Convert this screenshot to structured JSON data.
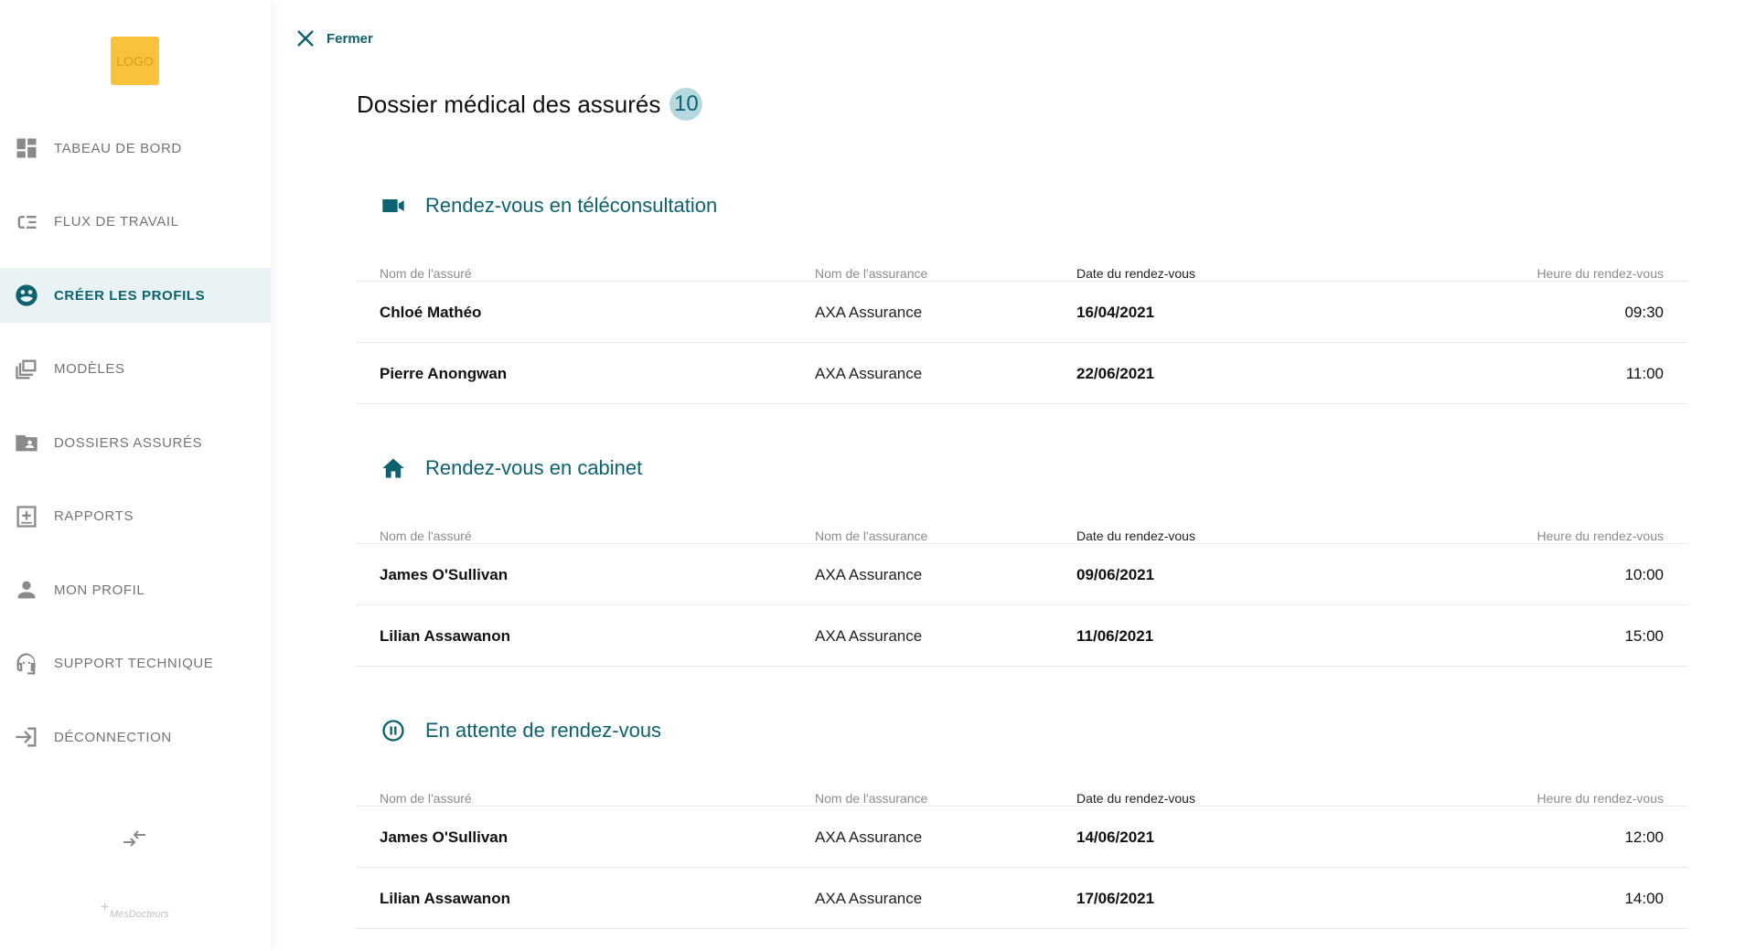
{
  "sidebar": {
    "logo_text": "LOGO",
    "items": [
      {
        "label": "TABEAU DE BORD",
        "icon": "dashboard-icon",
        "active": false
      },
      {
        "label": "FLUX DE TRAVAIL",
        "icon": "workflow-icon",
        "active": false
      },
      {
        "label": "CRÉER LES PROFILS",
        "icon": "profiles-icon",
        "active": true
      },
      {
        "label": "MODÈLES",
        "icon": "templates-icon",
        "active": false
      },
      {
        "label": "DOSSIERS ASSURÉS",
        "icon": "folder-user-icon",
        "active": false
      },
      {
        "label": "RAPPORTS",
        "icon": "report-icon",
        "active": false
      },
      {
        "label": "MON PROFIL",
        "icon": "person-icon",
        "active": false
      },
      {
        "label": "SUPPORT TECHNIQUE",
        "icon": "support-icon",
        "active": false
      },
      {
        "label": "DÉCONNECTION",
        "icon": "logout-icon",
        "active": false
      }
    ],
    "collapse_icon": "arrows-swap-icon",
    "brand_plus": "+",
    "brand_name": "MesDocteurs"
  },
  "header": {
    "close_label": "Fermer",
    "title": "Dossier médical des assurés",
    "count": "10"
  },
  "columns": {
    "name": "Nom de l'assuré",
    "insurance": "Nom de l'assurance",
    "date": "Date du rendez-vous",
    "time": "Heure du rendez-vous"
  },
  "sections": [
    {
      "title": "Rendez-vous en téléconsultation",
      "icon": "video-camera-icon",
      "rows": [
        {
          "name": "Chloé Mathéo",
          "insurance": "AXA Assurance",
          "date": "16/04/2021",
          "time": "09:30"
        },
        {
          "name": "Pierre Anongwan",
          "insurance": "AXA Assurance",
          "date": "22/06/2021",
          "time": "11:00"
        }
      ]
    },
    {
      "title": "Rendez-vous en cabinet",
      "icon": "home-icon",
      "rows": [
        {
          "name": "James O'Sullivan",
          "insurance": "AXA Assurance",
          "date": "09/06/2021",
          "time": "10:00"
        },
        {
          "name": "Lilian Assawanon",
          "insurance": "AXA Assurance",
          "date": "11/06/2021",
          "time": "15:00"
        }
      ]
    },
    {
      "title": "En attente de rendez-vous",
      "icon": "pause-circle-icon",
      "rows": [
        {
          "name": "James O'Sullivan",
          "insurance": "AXA Assurance",
          "date": "14/06/2021",
          "time": "12:00"
        },
        {
          "name": "Lilian Assawanon",
          "insurance": "AXA Assurance",
          "date": "17/06/2021",
          "time": "14:00"
        }
      ]
    }
  ],
  "colors": {
    "accent": "#0d6270",
    "badge_bg": "#b6d8df",
    "logo_bg": "#f9c23c",
    "active_bg": "#e9f3f5"
  }
}
